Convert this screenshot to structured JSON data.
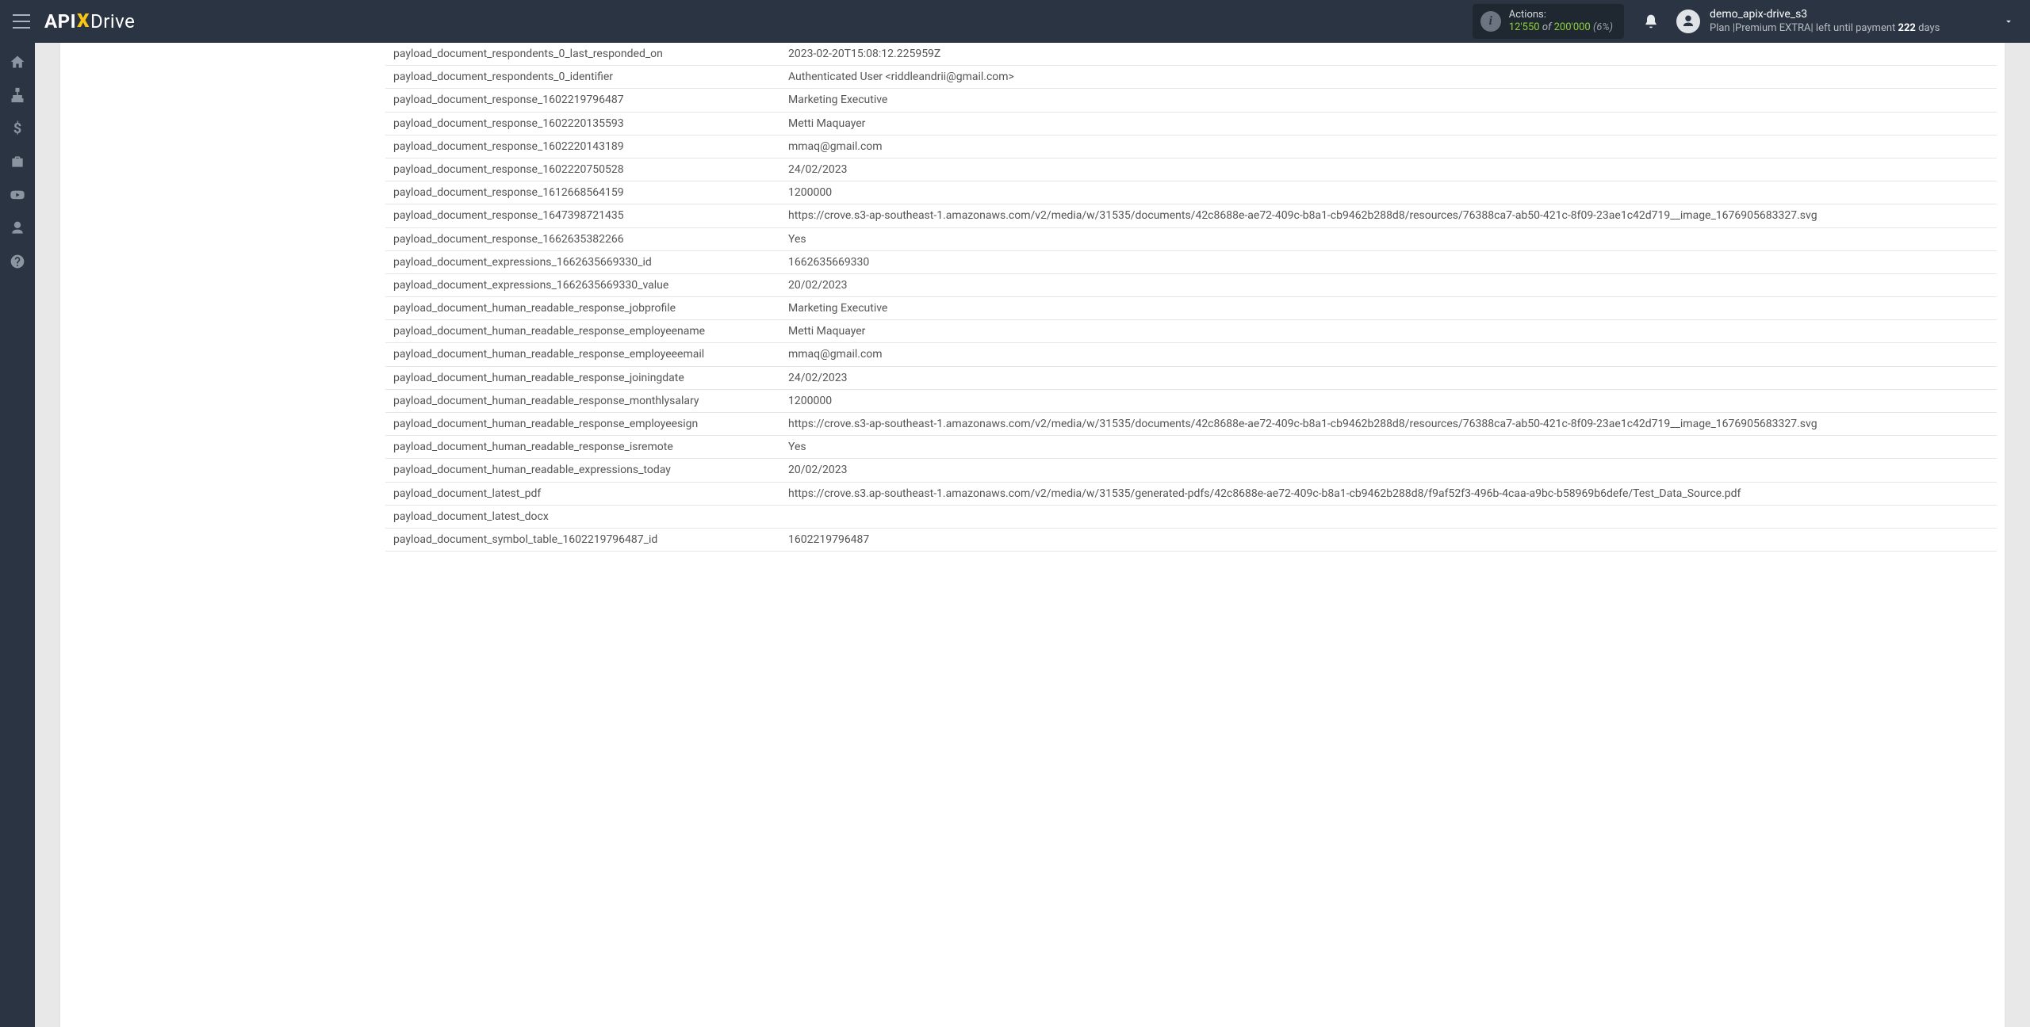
{
  "header": {
    "logo_api": "API",
    "logo_x": "X",
    "logo_drive": "Drive",
    "actions_label": "Actions:",
    "actions_used": "12'550",
    "actions_of": "of",
    "actions_total": "200'000",
    "actions_pct": "(6%)",
    "username": "demo_apix-drive_s3",
    "plan_prefix": "Plan |Premium EXTRA| left until payment ",
    "plan_days_num": "222",
    "plan_days_suffix": " days"
  },
  "sidebar": {
    "items": [
      "home",
      "sitemap",
      "dollar",
      "briefcase",
      "youtube",
      "user",
      "help"
    ]
  },
  "rows": [
    {
      "k": "payload_document_respondents_0_last_responded_on",
      "v": "2023-02-20T15:08:12.225959Z"
    },
    {
      "k": "payload_document_respondents_0_identifier",
      "v": "Authenticated User <riddleandrii@gmail.com>"
    },
    {
      "k": "payload_document_response_1602219796487",
      "v": "Marketing Executive"
    },
    {
      "k": "payload_document_response_1602220135593",
      "v": "Metti Maquayer"
    },
    {
      "k": "payload_document_response_1602220143189",
      "v": "mmaq@gmail.com"
    },
    {
      "k": "payload_document_response_1602220750528",
      "v": "24/02/2023"
    },
    {
      "k": "payload_document_response_1612668564159",
      "v": "1200000"
    },
    {
      "k": "payload_document_response_1647398721435",
      "v": "https://crove.s3-ap-southeast-1.amazonaws.com/v2/media/w/31535/documents/42c8688e-ae72-409c-b8a1-cb9462b288d8/resources/76388ca7-ab50-421c-8f09-23ae1c42d719__image_1676905683327.svg"
    },
    {
      "k": "payload_document_response_1662635382266",
      "v": "Yes"
    },
    {
      "k": "payload_document_expressions_1662635669330_id",
      "v": "1662635669330"
    },
    {
      "k": "payload_document_expressions_1662635669330_value",
      "v": "20/02/2023"
    },
    {
      "k": "payload_document_human_readable_response_jobprofile",
      "v": "Marketing Executive"
    },
    {
      "k": "payload_document_human_readable_response_employeename",
      "v": "Metti Maquayer"
    },
    {
      "k": "payload_document_human_readable_response_employeeemail",
      "v": "mmaq@gmail.com"
    },
    {
      "k": "payload_document_human_readable_response_joiningdate",
      "v": "24/02/2023"
    },
    {
      "k": "payload_document_human_readable_response_monthlysalary",
      "v": "1200000"
    },
    {
      "k": "payload_document_human_readable_response_employeesign",
      "v": "https://crove.s3-ap-southeast-1.amazonaws.com/v2/media/w/31535/documents/42c8688e-ae72-409c-b8a1-cb9462b288d8/resources/76388ca7-ab50-421c-8f09-23ae1c42d719__image_1676905683327.svg"
    },
    {
      "k": "payload_document_human_readable_response_isremote",
      "v": "Yes"
    },
    {
      "k": "payload_document_human_readable_expressions_today",
      "v": "20/02/2023"
    },
    {
      "k": "payload_document_latest_pdf",
      "v": "https://crove.s3.ap-southeast-1.amazonaws.com/v2/media/w/31535/generated-pdfs/42c8688e-ae72-409c-b8a1-cb9462b288d8/f9af52f3-496b-4caa-a9bc-b58969b6defe/Test_Data_Source.pdf"
    },
    {
      "k": "payload_document_latest_docx",
      "v": ""
    },
    {
      "k": "payload_document_symbol_table_1602219796487_id",
      "v": "1602219796487"
    }
  ]
}
